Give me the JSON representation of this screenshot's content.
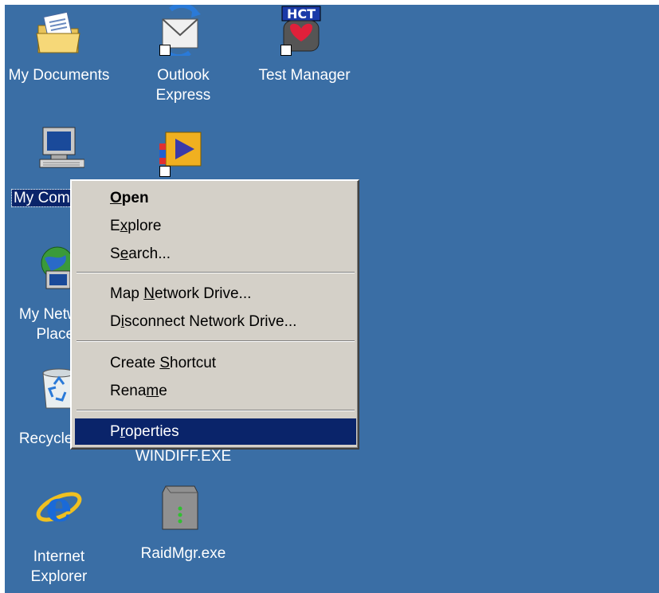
{
  "desktop": {
    "background": "#3a6ea5",
    "icons": [
      {
        "label": "My Documents",
        "icon": "folder-documents-icon"
      },
      {
        "label": "Outlook\nExpress",
        "icon": "outlook-express-icon"
      },
      {
        "label": "Test Manager",
        "icon": "hct-test-manager-icon"
      },
      {
        "label": "My Computer",
        "icon": "computer-icon"
      },
      {
        "label": "",
        "icon": "media-player-icon"
      },
      {
        "label": "My Network\nPlaces",
        "icon": "network-places-icon"
      },
      {
        "label": "Recycle Bin",
        "icon": "recycle-bin-icon"
      },
      {
        "label": "WINDIFF.EXE",
        "icon": "windiff-icon"
      },
      {
        "label": "Internet\nExplorer",
        "icon": "internet-explorer-icon"
      },
      {
        "label": "RaidMgr.exe",
        "icon": "raidmgr-icon"
      }
    ]
  },
  "context_menu": {
    "items": [
      {
        "label": "Open",
        "access_key": "O",
        "default": true
      },
      {
        "label": "Explore",
        "access_key": "x"
      },
      {
        "label": "Search...",
        "access_key": "e"
      },
      {
        "label": "Map Network Drive...",
        "access_key": "N"
      },
      {
        "label": "Disconnect Network Drive...",
        "access_key": "i"
      },
      {
        "label": "Create Shortcut",
        "access_key": "S"
      },
      {
        "label": "Rename",
        "access_key": "m"
      },
      {
        "label": "Properties",
        "access_key": "r",
        "highlighted": true
      }
    ]
  },
  "colors": {
    "desktop": "#3a6ea5",
    "menu_bg": "#d4d0c8",
    "highlight": "#0a246a"
  }
}
